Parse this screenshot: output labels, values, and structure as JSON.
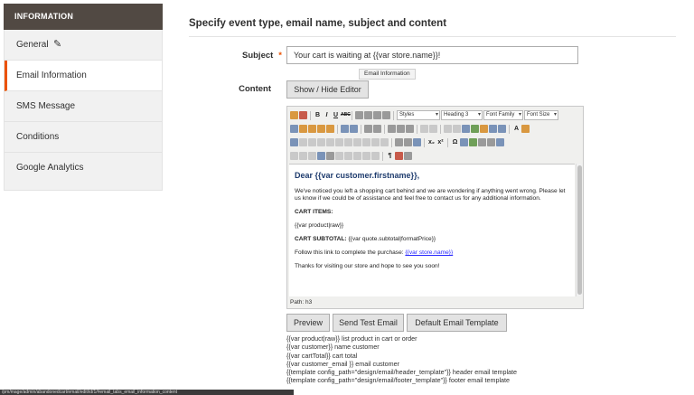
{
  "sidebar": {
    "header": "INFORMATION",
    "items": [
      {
        "label": "General"
      },
      {
        "label": "Email Information"
      },
      {
        "label": "SMS Message"
      },
      {
        "label": "Conditions"
      },
      {
        "label": "Google Analytics"
      }
    ]
  },
  "main": {
    "section_title": "Specify event type, email name, subject and content",
    "subject_label": "Subject",
    "required_mark": "*",
    "subject_value": "Your cart is waiting at {{var store.name}}!",
    "tooltip": "Email Information",
    "content_label": "Content",
    "toggle_editor_label": "Show / Hide Editor"
  },
  "editor": {
    "toolbar": {
      "styles": "Styles",
      "heading": "Heading 3",
      "font_family": "Font Family",
      "font_size": "Font Size",
      "bold": "B",
      "italic": "I",
      "underline": "U",
      "strike": "ABC",
      "subscript": "x₂",
      "superscript": "x²",
      "omega": "Ω",
      "pilcrow": "¶",
      "text_color": "A"
    },
    "body": {
      "heading": "Dear {{var customer.firstname}},",
      "p1": "We've noticed you left a shopping cart behind and we are wondering if anything went wrong. Please let us know if we could be of assistance and feel free to contact us for any additional information.",
      "cart_items": "CART ITEMS:",
      "product_var": "{{var product|raw}}",
      "subtotal_label": "CART SUBTOTAL:",
      "subtotal_var": "{{var quote.subtotal|formatPrice}}",
      "follow_text": "Follow this link to complete the purchase:",
      "follow_link": "{{var store.name}}",
      "thanks": "Thanks for visiting our store and hope to see you soon!"
    },
    "path": "Path: h3"
  },
  "buttons": {
    "preview": "Preview",
    "send_test": "Send Test Email",
    "default_template": "Default Email Template"
  },
  "variables_help": [
    "{{var product|raw}} list product in cart or order",
    "{{var customer}} name customer",
    "{{var cartTotal}} cart total",
    "{{var customer_email }} email customer",
    "{{template config_path=\"design/email/header_template\"}} header email template",
    "{{template config_path=\"design/email/footer_template\"}} footer email template"
  ],
  "status_bar": "/pm/mage/admin/abandonedcart/email/edit/id/1/#email_tabs_email_information_content",
  "colors": {
    "accent": "#eb5202",
    "sidebar_header": "#514943",
    "heading_text": "#1f3c6e",
    "link": "#2a2aff"
  }
}
